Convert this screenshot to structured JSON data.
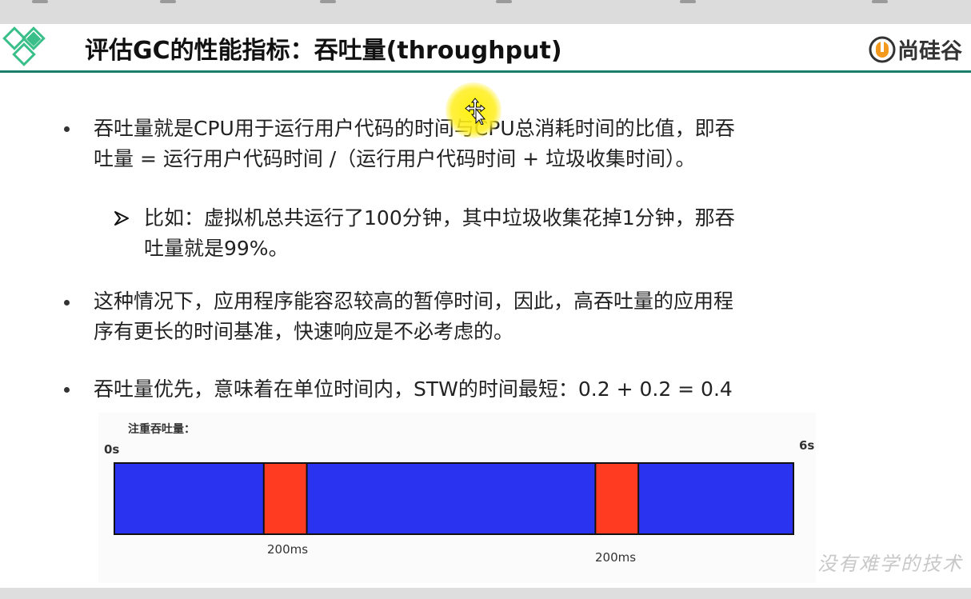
{
  "slide": {
    "title": "评估GC的性能指标：吞吐量(throughput)",
    "brand": "尚硅谷",
    "watermark": "没有难学的技术"
  },
  "bullets": {
    "b1_line1": "吞吐量就是CPU用于运行用户代码的时间与CPU总消耗时间的比值，即吞",
    "b1_line2": "吐量 = 运行用户代码时间 /（运行用户代码时间 + 垃圾收集时间）。",
    "sub_line1": "比如：虚拟机总共运行了100分钟，其中垃圾收集花掉1分钟，那吞",
    "sub_line2": "吐量就是99%。",
    "b2_line1": "这种情况下，应用程序能容忍较高的暂停时间，因此，高吞吐量的应用程",
    "b2_line2": "序有更长的时间基准，快速响应是不必考虑的。",
    "b3_line1": "吞吐量优先，意味着在单位时间内，STW的时间最短：0.2 + 0.2 = 0.4"
  },
  "timeline": {
    "caption": "注重吞吐量：",
    "start_label": "0s",
    "end_label": "6s",
    "total_seconds": 6,
    "pause_label_1": "200ms",
    "pause_label_2": "200ms",
    "pauses_seconds": [
      [
        1.32,
        1.7
      ],
      [
        4.25,
        4.63
      ]
    ],
    "run_color": "#2a33f0",
    "pause_color": "#ff3b22"
  },
  "colors": {
    "accent": "#1a7f6b",
    "diamond": "#3bbf8a",
    "brand_orange": "#f39a1e"
  }
}
